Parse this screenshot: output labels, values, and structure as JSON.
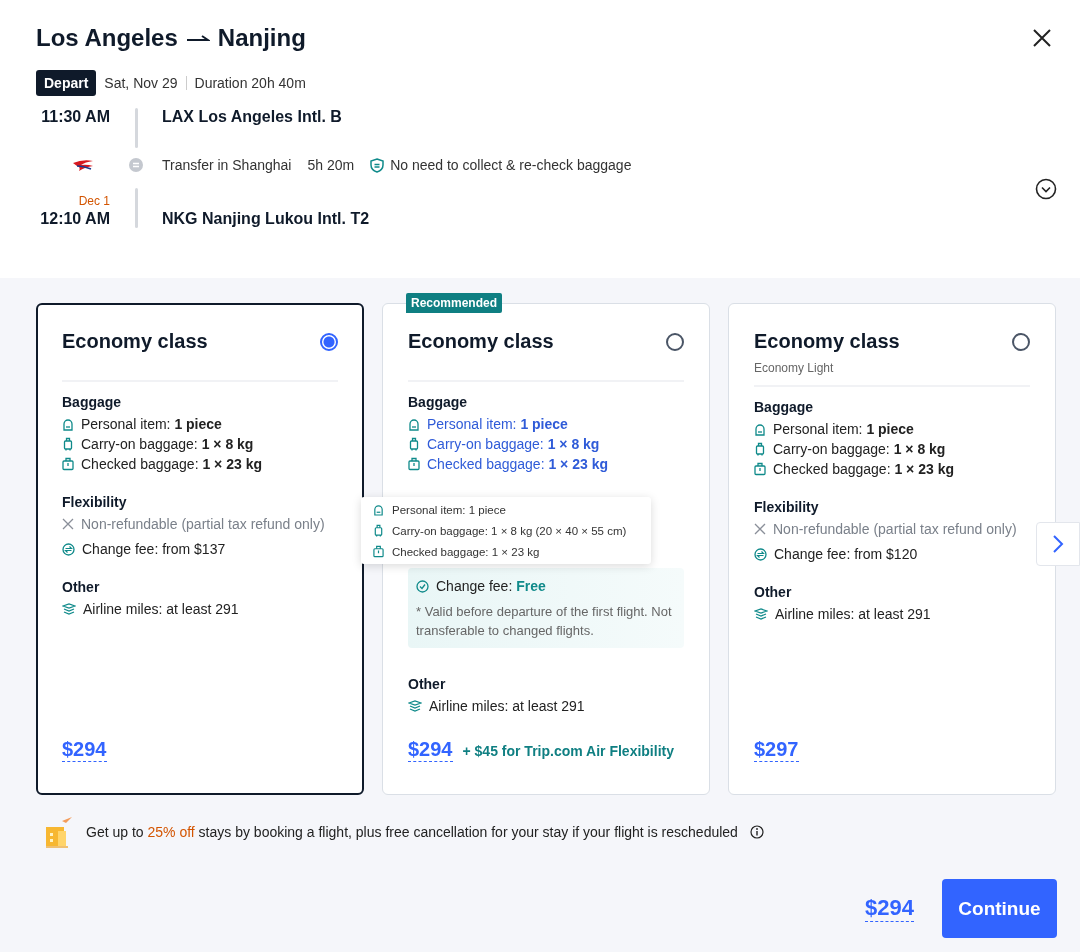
{
  "header": {
    "origin": "Los Angeles",
    "destination": "Nanjing",
    "badge": "Depart",
    "date": "Sat, Nov 29",
    "duration": "Duration 20h 40m"
  },
  "itinerary": {
    "departure": {
      "time": "11:30 AM",
      "airport": "LAX Los Angeles Intl. B"
    },
    "transfer": {
      "text": "Transfer in Shanghai",
      "duration": "5h 20m",
      "note": "No need to collect & re-check baggage"
    },
    "arrival": {
      "date_note": "Dec 1",
      "time": "12:10 AM",
      "airport": "NKG Nanjing Lukou Intl. T2"
    }
  },
  "fares": [
    {
      "title": "Economy class",
      "selected": true,
      "highlighted": false,
      "baggage_heading": "Baggage",
      "baggage": [
        {
          "kind": "personal",
          "label": "Personal item:",
          "value": "1 piece"
        },
        {
          "kind": "carryon",
          "label": "Carry-on baggage:",
          "value": "1 × 8 kg"
        },
        {
          "kind": "checked",
          "label": "Checked baggage:",
          "value": "1 × 23 kg"
        }
      ],
      "flexibility_heading": "Flexibility",
      "flexibility": [
        {
          "kind": "refund",
          "text": "Non-refundable (partial tax refund only)"
        },
        {
          "kind": "change",
          "text": "Change fee: from $137"
        }
      ],
      "other_heading": "Other",
      "other": [
        {
          "kind": "miles",
          "text": "Airline miles: at least 291"
        }
      ],
      "price": "$294"
    },
    {
      "title": "Economy class",
      "selected": false,
      "highlighted": true,
      "recommended": "Recommended",
      "baggage_heading": "Baggage",
      "baggage": [
        {
          "kind": "personal",
          "label": "Personal item:",
          "value": "1 piece"
        },
        {
          "kind": "carryon",
          "label": "Carry-on baggage:",
          "value": "1 × 8 kg"
        },
        {
          "kind": "checked",
          "label": "Checked baggage:",
          "value": "1 × 23 kg"
        }
      ],
      "flex_box": {
        "label": "Change fee:",
        "value": "Free",
        "note": "* Valid before departure of the first flight. Not transferable to changed flights."
      },
      "other_heading": "Other",
      "other": [
        {
          "kind": "miles",
          "text": "Airline miles: at least 291"
        }
      ],
      "price": "$294",
      "price_extra": "+ $45 for Trip.com Air Flexibility",
      "tooltip": [
        {
          "kind": "personal",
          "text": "Personal item: 1 piece"
        },
        {
          "kind": "carryon",
          "text": "Carry-on baggage: 1 × 8 kg (20 × 40 × 55 cm)"
        },
        {
          "kind": "checked",
          "text": "Checked baggage: 1 × 23 kg"
        }
      ]
    },
    {
      "title": "Economy class",
      "subtitle": "Economy Light",
      "selected": false,
      "highlighted": false,
      "baggage_heading": "Baggage",
      "baggage": [
        {
          "kind": "personal",
          "label": "Personal item:",
          "value": "1 piece"
        },
        {
          "kind": "carryon",
          "label": "Carry-on baggage:",
          "value": "1 × 8 kg"
        },
        {
          "kind": "checked",
          "label": "Checked baggage:",
          "value": "1 × 23 kg"
        }
      ],
      "flexibility_heading": "Flexibility",
      "flexibility": [
        {
          "kind": "refund",
          "text": "Non-refundable (partial tax refund only)"
        },
        {
          "kind": "change",
          "text": "Change fee: from $120"
        }
      ],
      "other_heading": "Other",
      "other": [
        {
          "kind": "miles",
          "text": "Airline miles: at least 291"
        }
      ],
      "price": "$297"
    }
  ],
  "promo": {
    "before": "Get up to ",
    "highlight": "25% off",
    "after": " stays by booking a flight, plus free cancellation for your stay if your flight is rescheduled"
  },
  "footer": {
    "total": "$294",
    "button": "Continue"
  }
}
